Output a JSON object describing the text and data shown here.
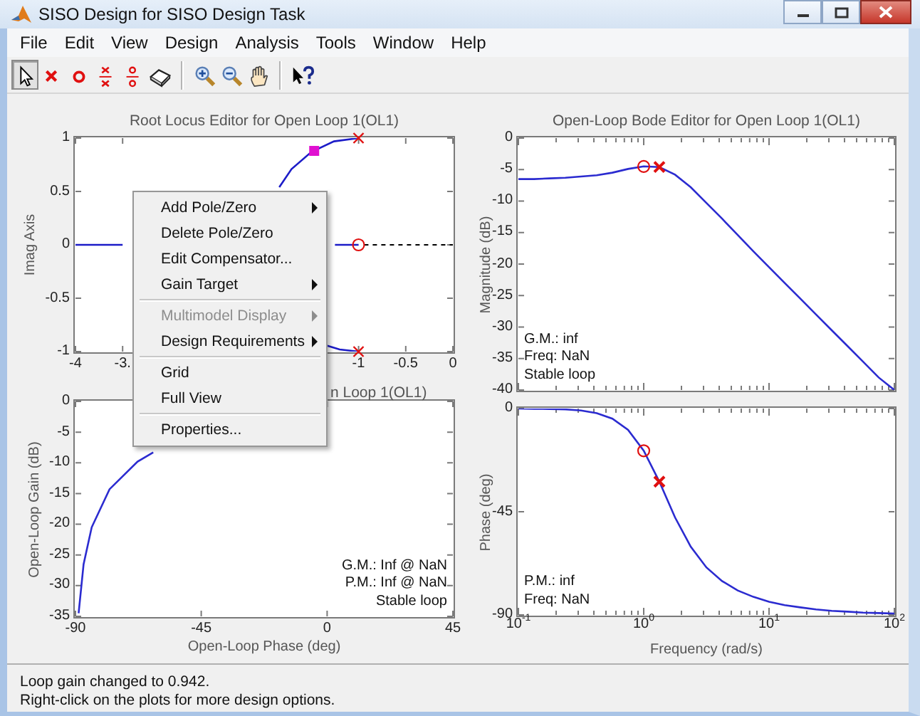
{
  "window": {
    "title": "SISO Design for SISO Design Task"
  },
  "menu_bar": [
    "File",
    "Edit",
    "View",
    "Design",
    "Analysis",
    "Tools",
    "Window",
    "Help"
  ],
  "toolbar": [
    {
      "kind": "pointer",
      "selected": true
    },
    {
      "kind": "add_pole",
      "selected": false
    },
    {
      "kind": "add_zero",
      "selected": false
    },
    {
      "kind": "add_complex_pole",
      "selected": false
    },
    {
      "kind": "add_complex_zero",
      "selected": false
    },
    {
      "kind": "erase",
      "selected": false
    },
    {
      "kind": "separator"
    },
    {
      "kind": "zoom_in",
      "selected": false
    },
    {
      "kind": "zoom_out",
      "selected": false
    },
    {
      "kind": "pan",
      "selected": false
    },
    {
      "kind": "separator"
    },
    {
      "kind": "whats_this",
      "selected": false
    }
  ],
  "plots": [
    {
      "kind": "root_locus",
      "title": "Root Locus Editor for Open Loop 1(OL1)",
      "chart_data": {
        "type": "line",
        "ylabel": "Imag Axis",
        "xlim": [
          -4,
          0
        ],
        "ylim": [
          -1,
          1
        ],
        "xticks": [
          -4,
          {
            "value": -3.5,
            "label": "-3."
          },
          -1,
          -0.5,
          0
        ],
        "yticks": [
          1,
          0.5,
          0,
          -0.5,
          -1
        ],
        "series": [
          {
            "color": "#1c1cc8",
            "x": [
              -1.84,
              -1.71,
              -1.5,
              -1.26,
              -1
            ],
            "values": [
              0.54,
              0.71,
              0.87,
              0.97,
              1
            ]
          },
          {
            "color": "#1c1cc8",
            "x": [
              -1.35,
              -1.2,
              -1
            ],
            "values": [
              -0.94,
              -0.98,
              -1
            ]
          },
          {
            "color": "#1c1cc8",
            "x": [
              -4,
              -3.75,
              -3.5
            ],
            "values": [
              0,
              0,
              0
            ]
          },
          {
            "color": "#1c1cc8",
            "x": [
              -1.25,
              -1
            ],
            "values": [
              0,
              0
            ]
          },
          {
            "color": "#000000",
            "line_style": "dashed",
            "x": [
              -0.94,
              0
            ],
            "values": [
              0,
              0
            ]
          },
          {
            "color": "#e010d0",
            "marker": "square",
            "x": [
              -1.47
            ],
            "values": [
              0.88
            ]
          },
          {
            "color": "#e01010",
            "marker": "x",
            "x": [
              -1
            ],
            "values": [
              1
            ]
          },
          {
            "color": "#e01010",
            "marker": "x",
            "x": [
              -1
            ],
            "values": [
              -1
            ]
          },
          {
            "color": "#e01010",
            "marker": "circle",
            "x": [
              -1
            ],
            "values": [
              0
            ]
          }
        ]
      }
    },
    {
      "kind": "bode_magnitude",
      "title": "Open-Loop Bode Editor for Open Loop 1(OL1)",
      "info": [
        "G.M.: inf",
        "Freq: NaN",
        "Stable loop"
      ],
      "chart_data": {
        "type": "line",
        "ylabel": "Magnitude (dB)",
        "categories": [
          null,
          null,
          null,
          null,
          null,
          null,
          null,
          null,
          null,
          null,
          null,
          null,
          null,
          null,
          null,
          null,
          null,
          null,
          null,
          null,
          null,
          null,
          null,
          null,
          null
        ],
        "ylim": [
          -40,
          0
        ],
        "yticks": [
          0,
          -5,
          -10,
          -15,
          -20,
          -25,
          -30,
          -35,
          -40
        ],
        "series": [
          {
            "color": "#2b2bd0",
            "values": [
              -6.5,
              -6.5,
              -6.4,
              -6.3,
              -6.1,
              -5.9,
              -5.5,
              -4.9,
              -4.5,
              -4.6,
              -5.8,
              -7.8,
              -10.3,
              -12.8,
              -15.4,
              -18,
              -20.5,
              -23,
              -25.5,
              -28,
              -30.5,
              -33,
              -35.5,
              -38,
              -40
            ]
          },
          {
            "color": "#e01010",
            "marker": "circle",
            "values": [
              null,
              null,
              null,
              null,
              null,
              null,
              null,
              null,
              -4.5,
              null,
              null,
              null,
              null,
              null,
              null,
              null,
              null,
              null,
              null,
              null,
              null,
              null,
              null,
              null,
              null
            ]
          },
          {
            "color": "#e01010",
            "marker": "x",
            "values": [
              null,
              null,
              null,
              null,
              null,
              null,
              null,
              null,
              null,
              -4.6,
              null,
              null,
              null,
              null,
              null,
              null,
              null,
              null,
              null,
              null,
              null,
              null,
              null,
              null,
              null
            ]
          }
        ]
      }
    },
    {
      "kind": "nichols",
      "title": "n Loop 1(OL1)",
      "info": [
        "G.M.: Inf @ NaN",
        "P.M.: Inf @ NaN",
        "Stable loop"
      ],
      "chart_data": {
        "type": "line",
        "xlabel": "Open-Loop Phase (deg)",
        "ylabel": "Open-Loop Gain (dB)",
        "x": [
          -88.9,
          -87.1,
          -84.2,
          -77.8,
          -67.8,
          -62.2
        ],
        "xlim": [
          -90,
          45
        ],
        "ylim": [
          -35,
          0
        ],
        "xticks": [
          -90,
          -45,
          0,
          45
        ],
        "yticks": [
          0,
          -5,
          -10,
          -15,
          -20,
          -25,
          -30,
          -35
        ],
        "series": [
          {
            "color": "#2b2bd0",
            "values": [
              -34.5,
              -26.5,
              -20.5,
              -14.3,
              -9.8,
              -8.3
            ]
          }
        ]
      }
    },
    {
      "kind": "bode_phase",
      "info": [
        "P.M.: inf",
        "Freq: NaN"
      ],
      "chart_data": {
        "type": "line",
        "xlabel": "Frequency (rad/s)",
        "ylabel": "Phase (deg)",
        "categories": [
          "10$^{-1}$",
          null,
          null,
          null,
          null,
          null,
          null,
          null,
          "10$^{0}$",
          null,
          null,
          null,
          null,
          null,
          null,
          null,
          "10$^{1}$",
          null,
          null,
          null,
          null,
          null,
          null,
          null,
          "10$^{2}$"
        ],
        "ylim": [
          -90,
          0
        ],
        "yticks": [
          0,
          -45,
          -90
        ],
        "series": [
          {
            "color": "#2b2bd0",
            "values": [
              0,
              -0.1,
              -0.2,
              -0.4,
              -0.9,
              -2,
              -4.4,
              -9.3,
              -18.4,
              -31.9,
              -47.5,
              -60.2,
              -69.3,
              -75.2,
              -79.3,
              -82.1,
              -84.2,
              -85.7,
              -86.7,
              -87.6,
              -88.2,
              -88.6,
              -89,
              -89.2,
              -89.4
            ]
          },
          {
            "color": "#e01010",
            "marker": "circle",
            "values": [
              null,
              null,
              null,
              null,
              null,
              null,
              null,
              null,
              -18.4,
              null,
              null,
              null,
              null,
              null,
              null,
              null,
              null,
              null,
              null,
              null,
              null,
              null,
              null,
              null,
              null
            ]
          },
          {
            "color": "#e01010",
            "marker": "x",
            "values": [
              null,
              null,
              null,
              null,
              null,
              null,
              null,
              null,
              null,
              -31.9,
              null,
              null,
              null,
              null,
              null,
              null,
              null,
              null,
              null,
              null,
              null,
              null,
              null,
              null,
              null
            ]
          }
        ]
      }
    }
  ],
  "context_menu": {
    "items": [
      {
        "kind": "item",
        "label": "Add Pole/Zero",
        "submenu": true,
        "disabled": false
      },
      {
        "kind": "item",
        "label": "Delete Pole/Zero",
        "submenu": false,
        "disabled": false
      },
      {
        "kind": "item",
        "label": "Edit Compensator...",
        "submenu": false,
        "disabled": false
      },
      {
        "kind": "item",
        "label": "Gain Target",
        "submenu": true,
        "disabled": false
      },
      {
        "kind": "separator"
      },
      {
        "kind": "item",
        "label": "Multimodel Display",
        "submenu": true,
        "disabled": true
      },
      {
        "kind": "item",
        "label": "Design Requirements",
        "submenu": true,
        "disabled": false
      },
      {
        "kind": "separator"
      },
      {
        "kind": "item",
        "label": "Grid",
        "submenu": false,
        "disabled": false
      },
      {
        "kind": "item",
        "label": "Full View",
        "submenu": false,
        "disabled": false
      },
      {
        "kind": "separator"
      },
      {
        "kind": "item",
        "label": "Properties...",
        "submenu": false,
        "disabled": false
      }
    ]
  },
  "status_bar": [
    "Loop gain changed to 0.942.",
    "Right-click on the plots for more design options."
  ]
}
